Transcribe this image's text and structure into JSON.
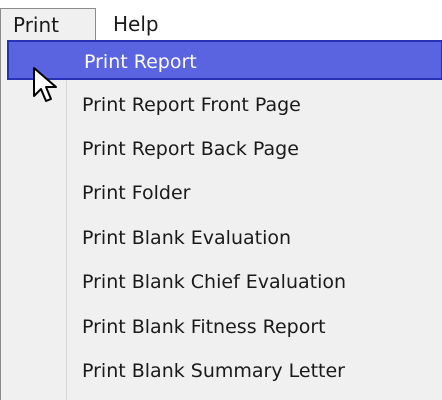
{
  "menubar": {
    "items": [
      {
        "label": "Print"
      },
      {
        "label": "Help"
      }
    ]
  },
  "dropdown": {
    "items": [
      {
        "label": "Print Report",
        "highlighted": true
      },
      {
        "label": "Print Report Front Page"
      },
      {
        "label": "Print Report Back Page"
      },
      {
        "label": "Print Folder"
      },
      {
        "label": "Print Blank Evaluation"
      },
      {
        "label": "Print Blank Chief Evaluation"
      },
      {
        "label": "Print Blank Fitness Report"
      },
      {
        "label": "Print Blank Summary Letter"
      }
    ]
  },
  "colors": {
    "highlight": "#5a64e0",
    "highlight_border": "#2731b5",
    "menu_bg": "#f0f0f0"
  },
  "icons": {
    "cursor": "mouse-pointer-icon"
  }
}
